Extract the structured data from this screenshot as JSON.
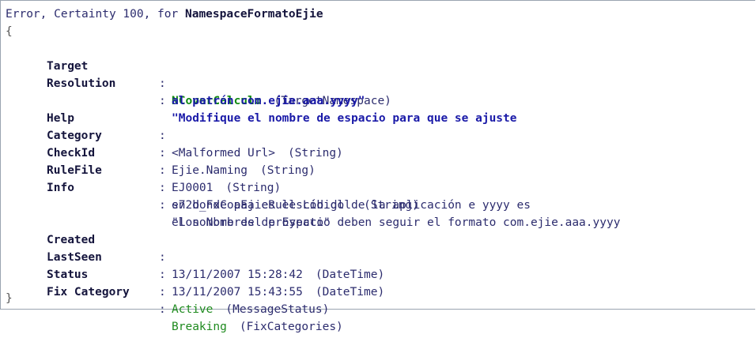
{
  "header": {
    "prefix": "Error, Certainty 100, for",
    "name": "NamespaceFormatoEjie"
  },
  "brace_open": "{",
  "brace_close": "}",
  "colon": ":",
  "fields": {
    "target": {
      "key": "Target",
      "value": "NCoverCalculo",
      "type": "(TargetNamespace)"
    },
    "resolution": {
      "key": "Resolution",
      "line1": "\"Modifique el nombre de espacio para que se ajuste",
      "line2": "al patrón com.ejie.aaa.yyyy\""
    },
    "help": {
      "key": "Help",
      "value": "<Malformed Url>",
      "type": "(String)"
    },
    "category": {
      "key": "Category",
      "value": "Ejie.Naming",
      "type": "(String)"
    },
    "checkid": {
      "key": "CheckId",
      "value": "EJ0001",
      "type": "(String)"
    },
    "rulefile": {
      "key": "RuleFile",
      "value": "s72b_FxCopEjieRulesLib.dll",
      "type": "(String)"
    },
    "info": {
      "key": "Info",
      "line1": "\"Los Nombres de Espacio deben seguir el formato com.ejie.aaa.yyyy",
      "line2": "en donde aaa es el código de la aplicación e yyyy es",
      "line3": "el nombre del proyecto\""
    },
    "created": {
      "key": "Created",
      "value": "13/11/2007 15:28:42",
      "type": "(DateTime)"
    },
    "lastseen": {
      "key": "LastSeen",
      "value": "13/11/2007 15:43:55",
      "type": "(DateTime)"
    },
    "status": {
      "key": "Status",
      "value": "Active",
      "type": "(MessageStatus)"
    },
    "fixcategory": {
      "key": "Fix Category",
      "value": "Breaking",
      "type": "(FixCategories)"
    }
  }
}
